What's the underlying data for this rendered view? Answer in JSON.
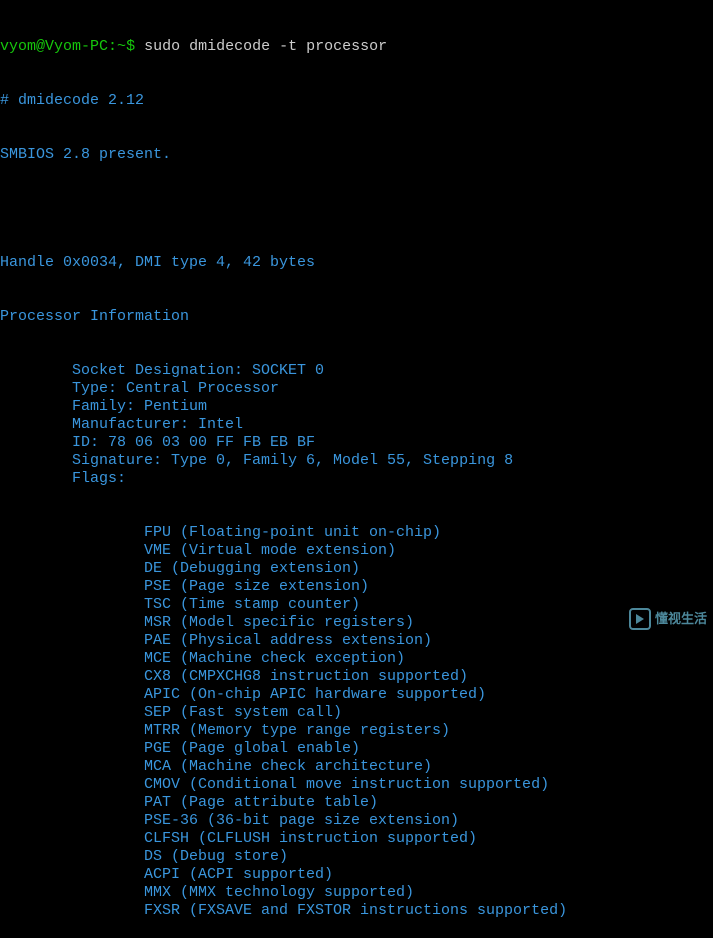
{
  "prompt": {
    "user_host": "vyom@Vyom-PC",
    "separator": ":",
    "path": "~",
    "symbol": "$",
    "command": "sudo dmidecode -t processor"
  },
  "header": {
    "comment": "# dmidecode 2.12",
    "smbios": "SMBIOS 2.8 present."
  },
  "handle": "Handle 0x0034, DMI type 4, 42 bytes",
  "section_title": "Processor Information",
  "fields": [
    "Socket Designation: SOCKET 0",
    "Type: Central Processor",
    "Family: Pentium",
    "Manufacturer: Intel",
    "ID: 78 06 03 00 FF FB EB BF",
    "Signature: Type 0, Family 6, Model 55, Stepping 8",
    "Flags:"
  ],
  "flags": [
    "FPU (Floating-point unit on-chip)",
    "VME (Virtual mode extension)",
    "DE (Debugging extension)",
    "PSE (Page size extension)",
    "TSC (Time stamp counter)",
    "MSR (Model specific registers)",
    "PAE (Physical address extension)",
    "MCE (Machine check exception)",
    "CX8 (CMPXCHG8 instruction supported)",
    "APIC (On-chip APIC hardware supported)",
    "SEP (Fast system call)",
    "MTRR (Memory type range registers)",
    "PGE (Page global enable)",
    "MCA (Machine check architecture)",
    "CMOV (Conditional move instruction supported)",
    "PAT (Page attribute table)",
    "PSE-36 (36-bit page size extension)",
    "CLFSH (CLFLUSH instruction supported)",
    "DS (Debug store)",
    "ACPI (ACPI supported)",
    "MMX (MMX technology supported)",
    "FXSR (FXSAVE and FXSTOR instructions supported)"
  ],
  "watermark": {
    "text": "懂视生活"
  }
}
